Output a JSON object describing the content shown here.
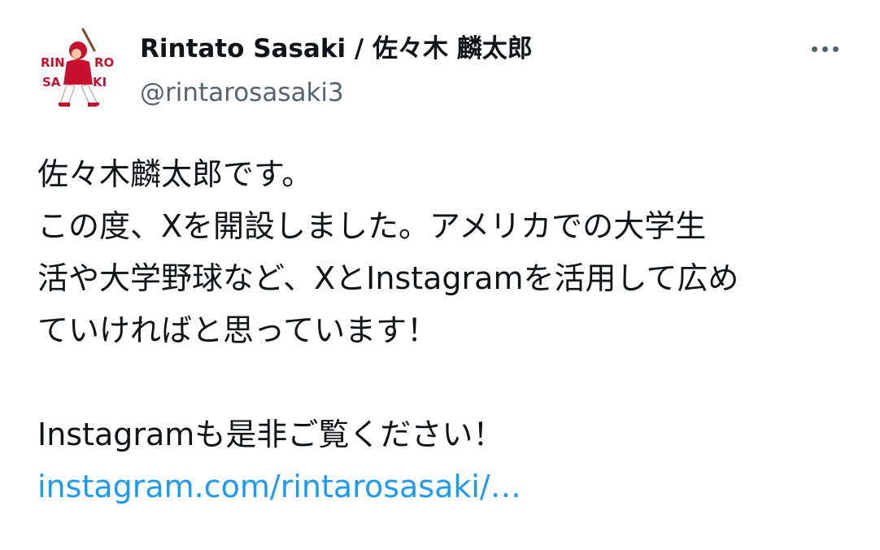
{
  "author": {
    "display_name": "Rintato Sasaki / 佐々木 麟太郎",
    "handle": "@rintarosasaki3",
    "avatar_text": "RINTARO SASAKI"
  },
  "tweet": {
    "lines": [
      "佐々木麟太郎です。",
      "この度、Xを開設しました。アメリカでの大学生",
      "活や大学野球など、XとInstagramを活用して広め",
      "ていければと思っています！",
      "",
      "Instagramも是非ご覧ください！"
    ],
    "link_text": "instagram.com/rintarosasaki/…"
  },
  "icons": {
    "more": "more-horizontal-icon"
  },
  "colors": {
    "text": "#0f1419",
    "secondary": "#536471",
    "link": "#1d9bf0",
    "avatar_red": "#c8102e"
  }
}
